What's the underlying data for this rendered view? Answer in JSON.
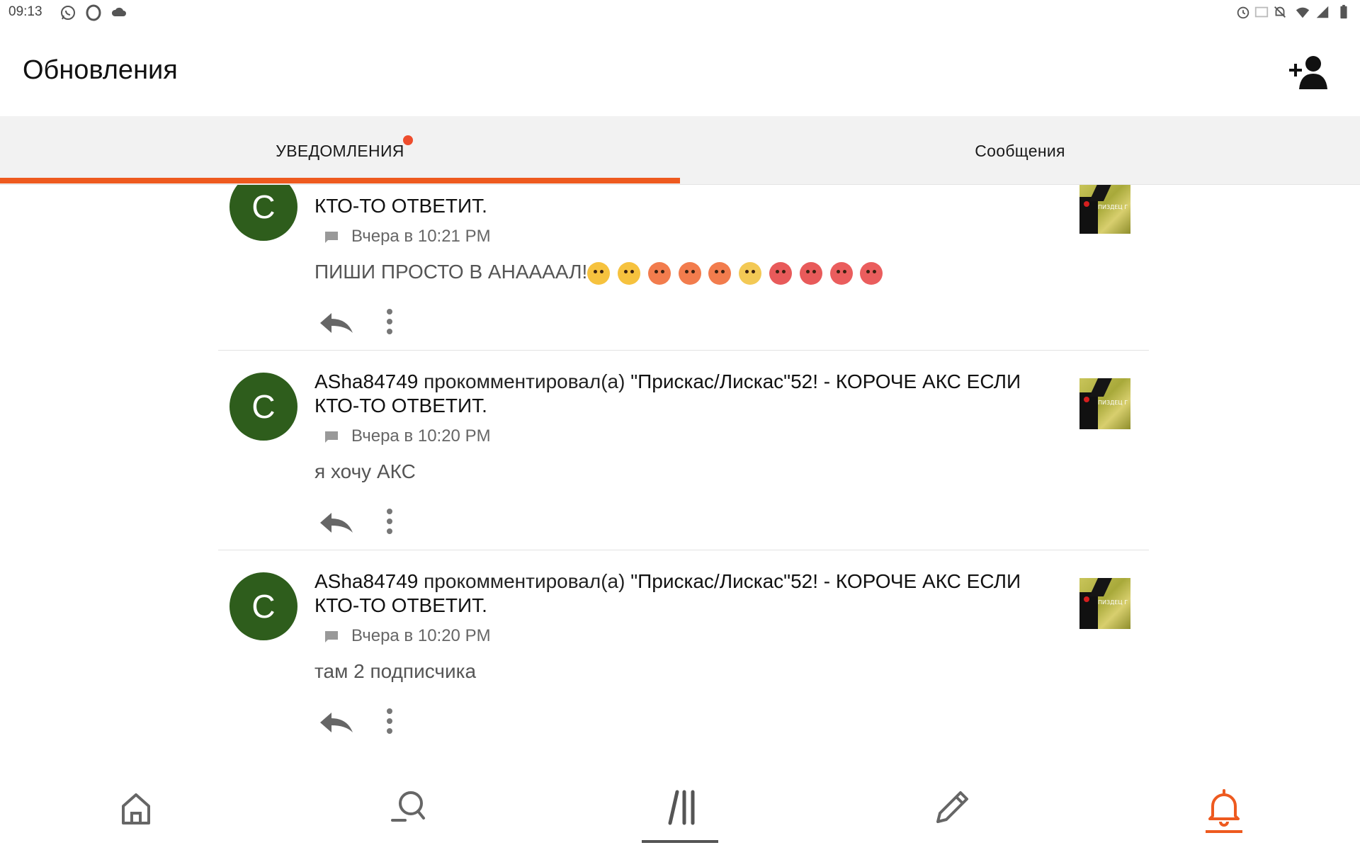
{
  "status_bar": {
    "time": "09:13"
  },
  "app_bar": {
    "title": "Обновления",
    "add_user_icon": "add-user-icon"
  },
  "tabs": [
    {
      "label": "Уведомления",
      "active": true,
      "has_badge": true
    },
    {
      "label": "Сообщения",
      "active": false,
      "has_badge": false
    }
  ],
  "colors": {
    "accent": "#ee5a1f",
    "avatar_bg": "#2e5d1c",
    "badge": "#ee4d2d"
  },
  "notifications": [
    {
      "avatar_letter": "C",
      "user": "",
      "action": "",
      "post_title": "КТО-ТО ОТВЕТИТ.",
      "time": "Вчера в 10:21 PM",
      "comment": "ПИШИ ПРОСТО В АНААААЛ!",
      "emojis": [
        "crazy-face",
        "squinting-tongue-face",
        "hot-face",
        "hot-face",
        "hot-face",
        "exploding-head",
        "cursing-face",
        "cursing-face",
        "angry-face",
        "angry-face"
      ],
      "thumb_caption": "ПИЗДЕЦ Г"
    },
    {
      "avatar_letter": "C",
      "user": "ASha84749",
      "action": " прокомментировал(а) ",
      "post_title": "\"Прискас/Лискас\"52! - КОРОЧЕ АКС ЕСЛИ КТО-ТО ОТВЕТИТ.",
      "time": "Вчера в 10:20 PM",
      "comment": "я хочу АКС",
      "emojis": [],
      "thumb_caption": "ПИЗДЕЦ Г"
    },
    {
      "avatar_letter": "C",
      "user": "ASha84749",
      "action": " прокомментировал(а) ",
      "post_title": "\"Прискас/Лискас\"52! - КОРОЧЕ АКС ЕСЛИ КТО-ТО ОТВЕТИТ.",
      "time": "Вчера в 10:20 PM",
      "comment": "там 2 подписчика",
      "emojis": [],
      "thumb_caption": "ПИЗДЕЦ Г"
    }
  ],
  "bottom_nav": [
    {
      "icon": "home-icon",
      "active": false
    },
    {
      "icon": "search-icon",
      "active": false
    },
    {
      "icon": "feed-icon",
      "active": false
    },
    {
      "icon": "pencil-icon",
      "active": false
    },
    {
      "icon": "bell-icon",
      "active": true
    }
  ]
}
